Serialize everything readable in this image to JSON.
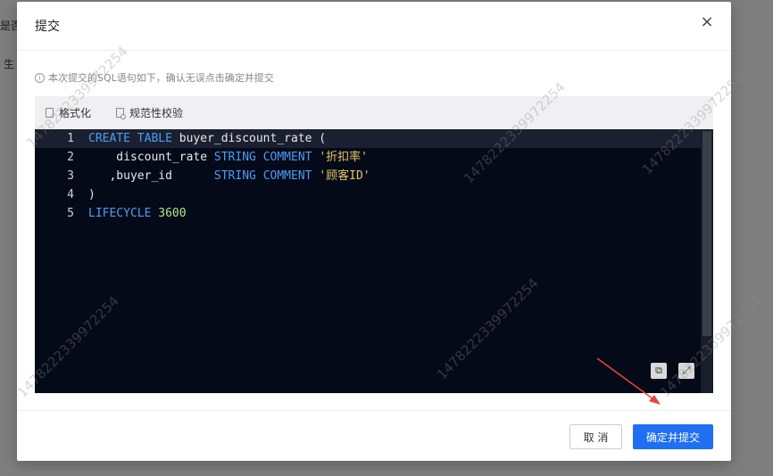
{
  "background": {
    "text_1": "是否",
    "text_2": "生"
  },
  "modal": {
    "title": "提交",
    "close_glyph": "×",
    "notice": "本次提交的SQL语句如下，确认无误点击确定并提交",
    "toolbar": {
      "format_label": "格式化",
      "check_label": "规范性校验"
    },
    "code_lines": [
      {
        "num": "1",
        "tokens": [
          {
            "t": "CREATE",
            "c": "kw"
          },
          {
            "t": " ",
            "c": ""
          },
          {
            "t": "TABLE",
            "c": "kw"
          },
          {
            "t": " buyer_discount_rate (",
            "c": ""
          }
        ]
      },
      {
        "num": "2",
        "tokens": [
          {
            "t": "    discount_rate ",
            "c": ""
          },
          {
            "t": "STRING",
            "c": "kw"
          },
          {
            "t": " ",
            "c": ""
          },
          {
            "t": "COMMENT",
            "c": "kw"
          },
          {
            "t": " ",
            "c": ""
          },
          {
            "t": "'折扣率'",
            "c": "str"
          }
        ]
      },
      {
        "num": "3",
        "tokens": [
          {
            "t": "   ,buyer_id      ",
            "c": ""
          },
          {
            "t": "STRING",
            "c": "kw"
          },
          {
            "t": " ",
            "c": ""
          },
          {
            "t": "COMMENT",
            "c": "kw"
          },
          {
            "t": " ",
            "c": ""
          },
          {
            "t": "'顾客ID'",
            "c": "str"
          }
        ]
      },
      {
        "num": "4",
        "tokens": [
          {
            "t": ")",
            "c": ""
          }
        ]
      },
      {
        "num": "5",
        "tokens": [
          {
            "t": "LIFECYCLE",
            "c": "kw"
          },
          {
            "t": " ",
            "c": ""
          },
          {
            "t": "3600",
            "c": "num"
          }
        ]
      }
    ],
    "copy_icon": "⧉",
    "fullscreen_icon": "⤢",
    "cancel_label": "取 消",
    "confirm_label": "确定并提交"
  },
  "watermark": "1478222339972254",
  "colors": {
    "primary": "#1f6ff2",
    "keyword": "#4a9df8",
    "string": "#e7c46a",
    "number": "#b5e38e",
    "editor_bg": "#050a18",
    "arrow": "#e8453c"
  }
}
